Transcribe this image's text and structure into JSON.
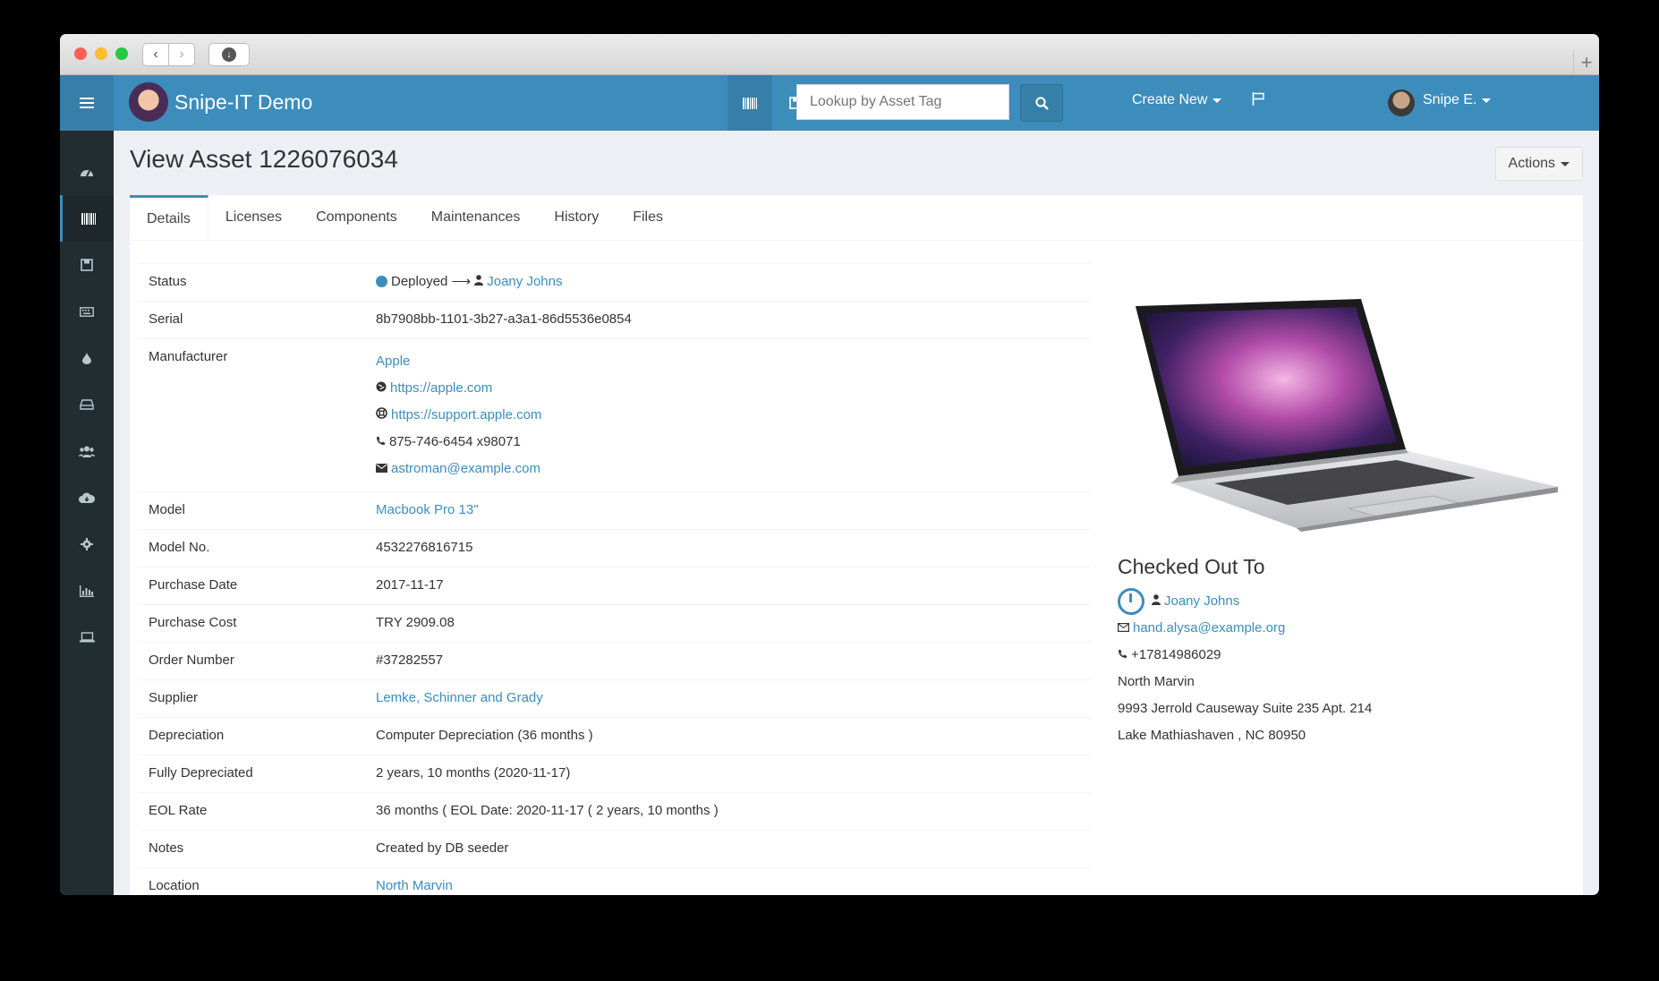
{
  "brand": {
    "name": "Snipe-IT Demo"
  },
  "header": {
    "search_placeholder": "Lookup by Asset Tag",
    "create_new": "Create New",
    "user_name": "Snipe E."
  },
  "page": {
    "title": "View Asset 1226076034",
    "actions_label": "Actions"
  },
  "tabs": [
    "Details",
    "Licenses",
    "Components",
    "Maintenances",
    "History",
    "Files"
  ],
  "details": {
    "status_label": "Status",
    "status_text": "Deployed",
    "status_arrow": "⟶",
    "status_assignee": "Joany Johns",
    "serial_label": "Serial",
    "serial": "8b7908bb-1101-3b27-a3a1-86d5536e0854",
    "manufacturer_label": "Manufacturer",
    "manufacturer": {
      "name": "Apple",
      "url": "https://apple.com",
      "support_url": "https://support.apple.com",
      "phone": "875-746-6454 x98071",
      "email": "astroman@example.com"
    },
    "model_label": "Model",
    "model": "Macbook Pro 13\"",
    "model_no_label": "Model No.",
    "model_no": "4532276816715",
    "purchase_date_label": "Purchase Date",
    "purchase_date": "2017-11-17",
    "purchase_cost_label": "Purchase Cost",
    "purchase_cost": "TRY 2909.08",
    "order_number_label": "Order Number",
    "order_number": "#37282557",
    "supplier_label": "Supplier",
    "supplier": "Lemke, Schinner and Grady",
    "depreciation_label": "Depreciation",
    "depreciation": "Computer Depreciation (36 months )",
    "fully_depreciated_label": "Fully Depreciated",
    "fully_depreciated": "2 years, 10 months (2020-11-17)",
    "eol_rate_label": "EOL Rate",
    "eol_rate": "36 months ( EOL Date: 2020-11-17 ( 2 years, 10 months )",
    "notes_label": "Notes",
    "notes": "Created by DB seeder",
    "location_label": "Location",
    "location": "North Marvin"
  },
  "checked_out": {
    "title": "Checked Out To",
    "name": "Joany Johns",
    "email": "hand.alysa@example.org",
    "phone": "+17814986029",
    "location": "North Marvin",
    "address1": "9993 Jerrold Causeway Suite 235 Apt. 214",
    "address2": "Lake Mathiashaven , NC 80950"
  },
  "colors": {
    "header": "#3c8dbc",
    "sidebar": "#222d32",
    "link": "#3c8dbc"
  }
}
